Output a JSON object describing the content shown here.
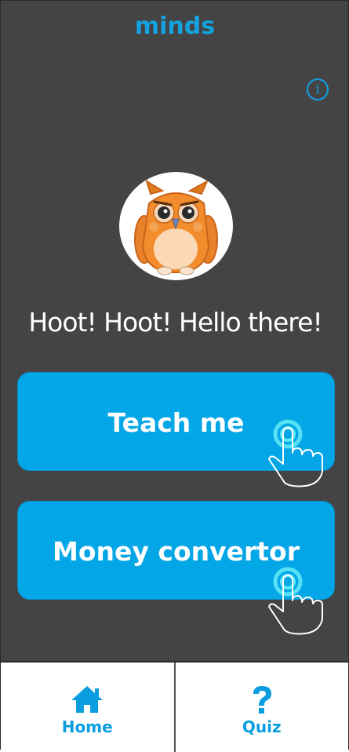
{
  "app": {
    "logo_text": "minds"
  },
  "header": {
    "info_glyph": "i"
  },
  "greeting": "Hoot! Hoot! Hello there!",
  "buttons": {
    "teach_label": "Teach me",
    "money_label": "Money convertor"
  },
  "nav": {
    "home_label": "Home",
    "quiz_label": "Quiz"
  },
  "colors": {
    "background": "#444444",
    "accent": "#03a6e6",
    "nav_text": "#0a9ee0",
    "owl": "#f28c2c"
  },
  "icons": [
    "info-icon",
    "owl-mascot",
    "tap-hand-icon",
    "home-icon",
    "question-icon"
  ]
}
